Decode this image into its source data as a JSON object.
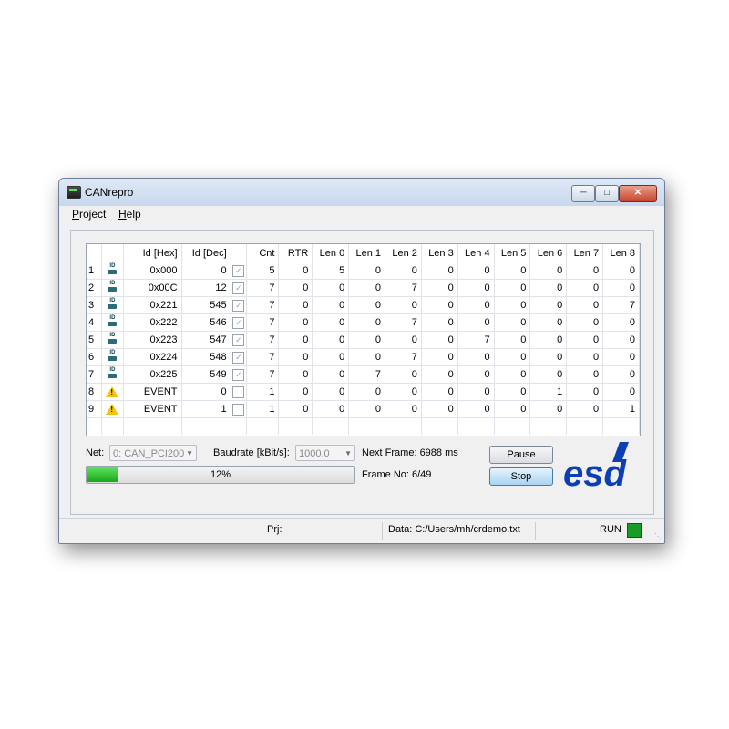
{
  "window": {
    "title": "CANrepro"
  },
  "menu": [
    {
      "key": "P",
      "rest": "roject"
    },
    {
      "key": "H",
      "rest": "elp"
    }
  ],
  "table": {
    "columns": [
      "",
      "",
      "Id [Hex]",
      "Id [Dec]",
      "",
      "Cnt",
      "RTR",
      "Len 0",
      "Len 1",
      "Len 2",
      "Len 3",
      "Len 4",
      "Len 5",
      "Len 6",
      "Len 7",
      "Len 8"
    ],
    "rows": [
      {
        "n": "1",
        "icon": "can-frame-icon",
        "hex": "0x000",
        "dec": "0",
        "checked": true,
        "vals": [
          "5",
          "0",
          "5",
          "0",
          "0",
          "0",
          "0",
          "0",
          "0",
          "0",
          "0"
        ]
      },
      {
        "n": "2",
        "icon": "can-frame-icon",
        "hex": "0x00C",
        "dec": "12",
        "checked": true,
        "vals": [
          "7",
          "0",
          "0",
          "0",
          "7",
          "0",
          "0",
          "0",
          "0",
          "0",
          "0"
        ]
      },
      {
        "n": "3",
        "icon": "can-frame-icon",
        "hex": "0x221",
        "dec": "545",
        "checked": true,
        "vals": [
          "7",
          "0",
          "0",
          "0",
          "0",
          "0",
          "0",
          "0",
          "0",
          "0",
          "7"
        ]
      },
      {
        "n": "4",
        "icon": "can-frame-icon",
        "hex": "0x222",
        "dec": "546",
        "checked": true,
        "vals": [
          "7",
          "0",
          "0",
          "0",
          "7",
          "0",
          "0",
          "0",
          "0",
          "0",
          "0"
        ]
      },
      {
        "n": "5",
        "icon": "can-frame-icon",
        "hex": "0x223",
        "dec": "547",
        "checked": true,
        "vals": [
          "7",
          "0",
          "0",
          "0",
          "0",
          "0",
          "7",
          "0",
          "0",
          "0",
          "0"
        ]
      },
      {
        "n": "6",
        "icon": "can-frame-icon",
        "hex": "0x224",
        "dec": "548",
        "checked": true,
        "vals": [
          "7",
          "0",
          "0",
          "0",
          "7",
          "0",
          "0",
          "0",
          "0",
          "0",
          "0"
        ]
      },
      {
        "n": "7",
        "icon": "can-frame-icon",
        "hex": "0x225",
        "dec": "549",
        "checked": true,
        "vals": [
          "7",
          "0",
          "0",
          "7",
          "0",
          "0",
          "0",
          "0",
          "0",
          "0",
          "0"
        ]
      },
      {
        "n": "8",
        "icon": "warning-icon",
        "hex": "EVENT",
        "dec": "0",
        "checked": false,
        "vals": [
          "1",
          "0",
          "0",
          "0",
          "0",
          "0",
          "0",
          "0",
          "1",
          "0",
          "0"
        ]
      },
      {
        "n": "9",
        "icon": "warning-icon",
        "hex": "EVENT",
        "dec": "1",
        "checked": false,
        "vals": [
          "1",
          "0",
          "0",
          "0",
          "0",
          "0",
          "0",
          "0",
          "0",
          "0",
          "1"
        ]
      }
    ]
  },
  "controls": {
    "net_label": "Net:",
    "net_value": "0: CAN_PCI200",
    "baud_label": "Baudrate [kBit/s]:",
    "baud_value": "1000.0",
    "next_frame": "Next Frame: 6988 ms",
    "frame_no": "Frame No: 6/49",
    "pause": "Pause",
    "stop": "Stop",
    "progress_percent": 12,
    "progress_text": "12%"
  },
  "logo": {
    "text": "esd",
    "color": "#0b3fb3"
  },
  "status": {
    "prj": "Prj:",
    "data": "Data: C:/Users/mh/crdemo.txt",
    "run": "RUN",
    "run_color": "#1a9b28"
  }
}
